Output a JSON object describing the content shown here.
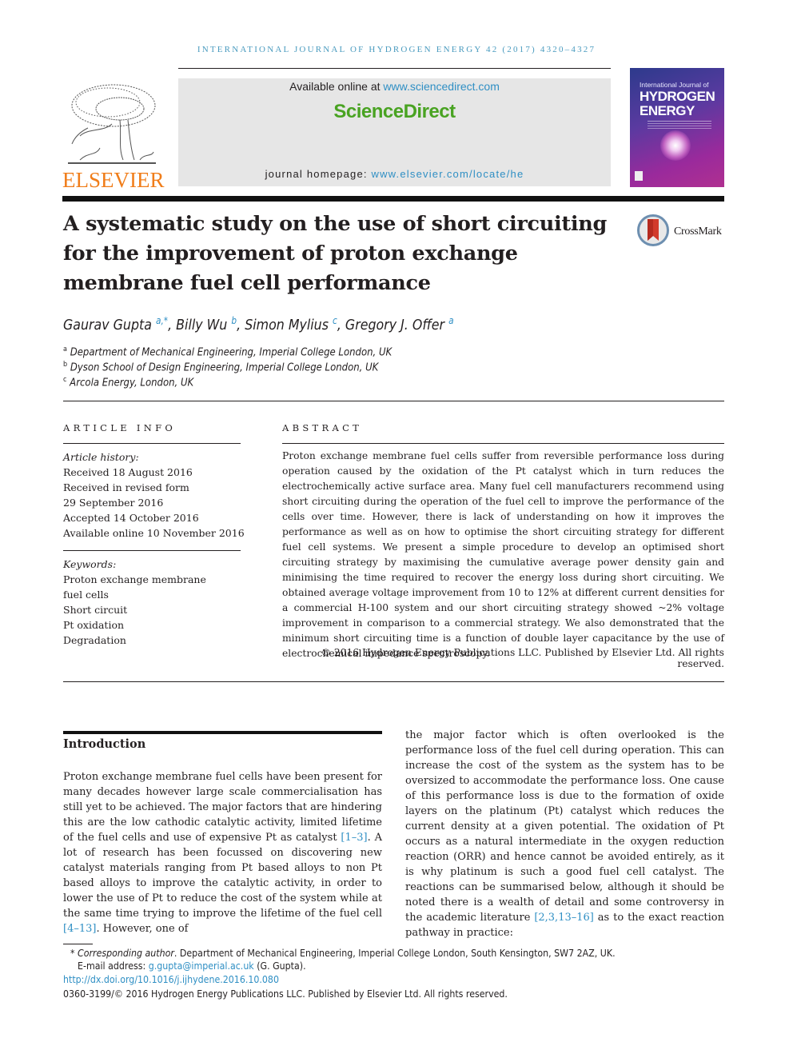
{
  "running_head": "INTERNATIONAL JOURNAL OF HYDROGEN ENERGY 42 (2017) 4320–4327",
  "banner": {
    "available_prefix": "Available online at ",
    "available_link": "www.sciencedirect.com",
    "brand": "ScienceDirect",
    "homepage_prefix": "journal homepage: ",
    "homepage_link": "www.elsevier.com/locate/he"
  },
  "publisher": {
    "name": "ELSEVIER"
  },
  "cover": {
    "top_line": "International Journal of",
    "title_line1": "HYDROGEN",
    "title_line2": "ENERGY"
  },
  "crossmark_label": "CrossMark",
  "title": "A systematic study on the use of short circuiting for the improvement of proton exchange membrane fuel cell performance",
  "authors": [
    {
      "name": "Gaurav Gupta",
      "sup": "a,*"
    },
    {
      "name": "Billy Wu",
      "sup": "b"
    },
    {
      "name": "Simon Mylius",
      "sup": "c"
    },
    {
      "name": "Gregory J. Offer",
      "sup": "a"
    }
  ],
  "affiliations": [
    {
      "key": "a",
      "text": "Department of Mechanical Engineering, Imperial College London, UK"
    },
    {
      "key": "b",
      "text": "Dyson School of Design Engineering, Imperial College London, UK"
    },
    {
      "key": "c",
      "text": "Arcola Energy, London, UK"
    }
  ],
  "article_info": {
    "heading": "ARTICLE INFO",
    "history_label": "Article history:",
    "history": [
      "Received 18 August 2016",
      "Received in revised form",
      "29 September 2016",
      "Accepted 14 October 2016",
      "Available online 10 November 2016"
    ],
    "keywords_label": "Keywords:",
    "keywords": [
      "Proton exchange membrane",
      "fuel cells",
      "Short circuit",
      "Pt oxidation",
      "Degradation"
    ]
  },
  "abstract": {
    "heading": "ABSTRACT",
    "text": "Proton exchange membrane fuel cells suffer from reversible performance loss during operation caused by the oxidation of the Pt catalyst which in turn reduces the electrochemically active surface area. Many fuel cell manufacturers recommend using short circuiting during the operation of the fuel cell to improve the performance of the cells over time. However, there is lack of understanding on how it improves the performance as well as on how to optimise the short circuiting strategy for different fuel cell systems. We present a simple procedure to develop an optimised short circuiting strategy by maximising the cumulative average power density gain and minimising the time required to recover the energy loss during short circuiting. We obtained average voltage improvement from 10 to 12% at different current densities for a commercial H-100 system and our short circuiting strategy showed ~2% voltage improvement in comparison to a commercial strategy. We also demonstrated that the minimum short circuiting time is a function of double layer capacitance by the use of electrochemical impedance spectroscopy.",
    "copyright": "© 2016 Hydrogen Energy Publications LLC. Published by Elsevier Ltd. All rights reserved."
  },
  "introduction": {
    "heading": "Introduction",
    "left": {
      "p1": "Proton exchange membrane fuel cells have been present for many decades however large scale commercialisation has still yet to be achieved. The major factors that are hindering this are the low cathodic catalytic activity, limited lifetime of the fuel cells and use of expensive Pt as catalyst ",
      "ref1": "[1–3]",
      "p2": ". A lot of research has been focussed on discovering new catalyst materials ranging from Pt based alloys to non Pt based alloys to improve the catalytic activity, in order to lower the use of Pt to reduce the cost of the system while at the same time trying to improve the lifetime of the fuel cell ",
      "ref2": "[4–13]",
      "p3": ". However, one of"
    },
    "right": {
      "p1": "the major factor which is often overlooked is the performance loss of the fuel cell during operation. This can increase the cost of the system as the system has to be oversized to accommodate the performance loss. One cause of this performance loss is due to the formation of oxide layers on the platinum (Pt) catalyst which reduces the current density at a given potential. The oxidation of Pt occurs as a natural intermediate in the oxygen reduction reaction (ORR) and hence cannot be avoided entirely, as it is why platinum is such a good fuel cell catalyst. The reactions can be summarised below, although it should be noted there is a wealth of detail and some controversy in the academic literature ",
      "ref1": "[2,3,13–16]",
      "p2": " as to the exact reaction pathway in practice:"
    }
  },
  "footnotes": {
    "corresponding_mark": "*",
    "corresponding_label": "Corresponding author",
    "corresponding_text": ". Department of Mechanical Engineering, Imperial College London, South Kensington, SW7 2AZ, UK.",
    "email_label": "E-mail address: ",
    "email": "g.gupta@imperial.ac.uk",
    "email_suffix": " (G. Gupta).",
    "doi": "http://dx.doi.org/10.1016/j.ijhydene.2016.10.080",
    "issn_copyright": "0360-3199/© 2016 Hydrogen Energy Publications LLC. Published by Elsevier Ltd. All rights reserved."
  },
  "colors": {
    "link": "#2f8fc4",
    "sciencedirect_green": "#49a322",
    "elsevier_orange": "#f07d1a",
    "running_head": "#4a9bbf"
  }
}
